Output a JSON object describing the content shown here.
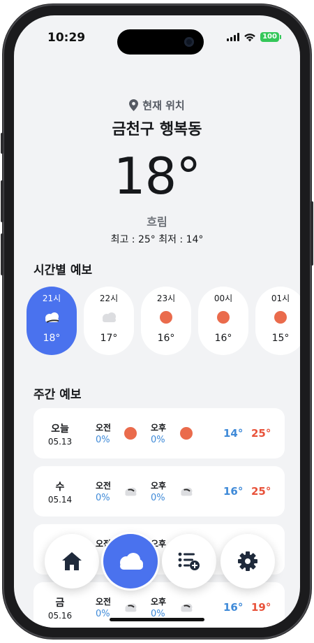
{
  "status_bar": {
    "time": "10:29",
    "battery": "100"
  },
  "location": {
    "label": "현재 위치",
    "city": "금천구 행복동"
  },
  "current": {
    "temp": "18°",
    "condition": "흐림",
    "hilo": "최고 : 25°   최저 : 14°"
  },
  "hourly": {
    "title": "시간별 예보",
    "items": [
      {
        "time": "21시",
        "icon": "cloud-icon",
        "temp": "18°"
      },
      {
        "time": "22시",
        "icon": "cloud-icon",
        "temp": "17°"
      },
      {
        "time": "23시",
        "icon": "sun-icon",
        "temp": "16°"
      },
      {
        "time": "00시",
        "icon": "sun-icon",
        "temp": "16°"
      },
      {
        "time": "01시",
        "icon": "sun-icon",
        "temp": "15°"
      }
    ]
  },
  "weekly": {
    "title": "주간 예보",
    "am_label": "오전",
    "pm_label": "오후",
    "days": [
      {
        "name": "오늘",
        "date": "05.13",
        "am_pct": "0%",
        "am_icon": "sun-icon",
        "pm_pct": "0%",
        "pm_icon": "sun-icon",
        "min": "14°",
        "max": "25°"
      },
      {
        "name": "수",
        "date": "05.14",
        "am_pct": "0%",
        "am_icon": "cloud-icon",
        "pm_pct": "0%",
        "pm_icon": "cloud-icon",
        "min": "16°",
        "max": "25°"
      },
      {
        "name": "",
        "date": "",
        "am_pct": "",
        "am_icon": "cloud-icon",
        "pm_pct": "",
        "pm_icon": "cloud-icon",
        "min": "",
        "max": ""
      },
      {
        "name": "금",
        "date": "05.16",
        "am_pct": "0%",
        "am_icon": "cloud-icon",
        "pm_pct": "0%",
        "pm_icon": "cloud-icon",
        "min": "16°",
        "max": "19°"
      }
    ]
  },
  "colors": {
    "accent": "#4a72ee",
    "sun": "#ea6b4c",
    "min_temp": "#3f8ad8",
    "max_temp": "#e8523a"
  },
  "nav": {
    "items": [
      {
        "icon": "home-icon"
      },
      {
        "icon": "cloud-icon",
        "active": true
      },
      {
        "icon": "list-add-icon"
      },
      {
        "icon": "gear-icon"
      }
    ]
  }
}
